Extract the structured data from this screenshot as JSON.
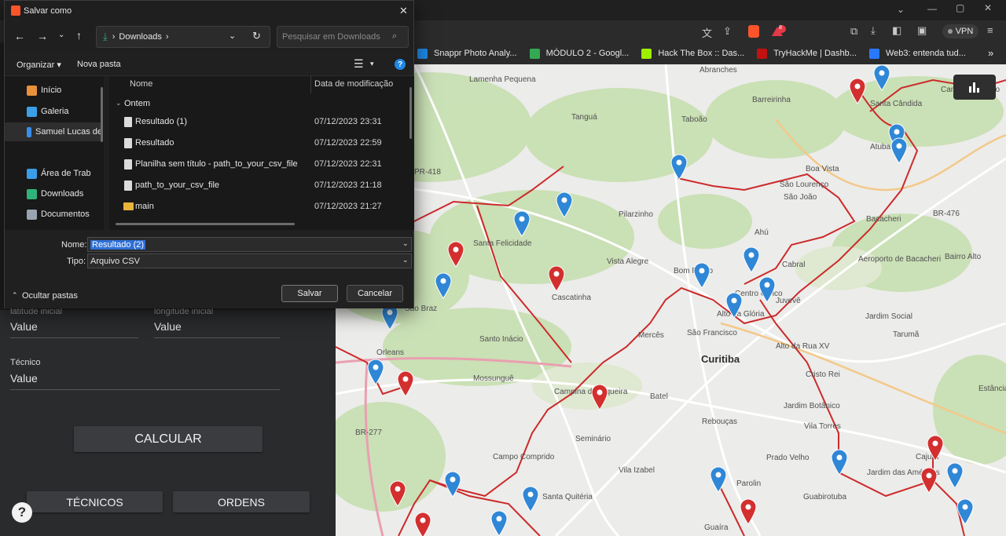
{
  "browser": {
    "bookmarks": [
      {
        "label": "Snappr Photo Analy...",
        "color": "#1e88e5"
      },
      {
        "label": "MÓDULO 2 - Googl...",
        "color": "#34a853"
      },
      {
        "label": "Hack The Box :: Das...",
        "color": "#9fef00"
      },
      {
        "label": "TryHackMe | Dashb...",
        "color": "#c11111"
      },
      {
        "label": "Web3: entenda tud...",
        "color": "#2979ff"
      }
    ],
    "more_bookmarks": "»",
    "vpn_label": "VPN",
    "brave_badge": "8"
  },
  "dialog": {
    "title": "Salvar como",
    "address": {
      "folder": "Downloads",
      "sep": "›"
    },
    "search_placeholder": "Pesquisar em Downloads",
    "cmd": {
      "organize": "Organizar ▾",
      "new_folder": "Nova pasta"
    },
    "nav_items": [
      {
        "label": "Início",
        "color": "#e8913b"
      },
      {
        "label": "Galeria",
        "color": "#3aa0e8"
      },
      {
        "label": "Samuel Lucas de",
        "color": "#3a8ee8"
      },
      {
        "label": "Área de Trab",
        "color": "#3a9ee8"
      },
      {
        "label": "Downloads",
        "color": "#2fb37a"
      },
      {
        "label": "Documentos",
        "color": "#9aa4b0"
      }
    ],
    "columns": {
      "name": "Nome",
      "date": "Data de modificação"
    },
    "group_label": "Ontem",
    "files": [
      {
        "name": "Resultado (1)",
        "date": "07/12/2023 23:31",
        "kind": "file"
      },
      {
        "name": "Resultado",
        "date": "07/12/2023 22:59",
        "kind": "file"
      },
      {
        "name": "Planilha sem título - path_to_your_csv_file",
        "date": "07/12/2023 22:31",
        "kind": "file"
      },
      {
        "name": "path_to_your_csv_file",
        "date": "07/12/2023 21:18",
        "kind": "file"
      },
      {
        "name": "main",
        "date": "07/12/2023 21:27",
        "kind": "folder"
      }
    ],
    "name_label": "Nome:",
    "name_value": "Resultado (2)",
    "type_label": "Tipo:",
    "type_value": "Arquivo CSV",
    "hide_folders": "Ocultar pastas",
    "save_button": "Salvar",
    "cancel_button": "Cancelar"
  },
  "app": {
    "lat_label": "latitude inicial",
    "lat_value": "Value",
    "lon_label": "longitude inicial",
    "lon_value": "Value",
    "tech_label": "Técnico",
    "tech_value": "Value",
    "calculate_button": "CALCULAR",
    "technicians_button": "TÉCNICOS",
    "orders_button": "ORDENS",
    "help_icon": "?"
  },
  "map": {
    "labels": [
      {
        "text": "Abranches",
        "cls": ""
      },
      {
        "text": "Lamenha Pequena",
        "cls": ""
      },
      {
        "text": "Barreirinha",
        "cls": ""
      },
      {
        "text": "Santa Cândida",
        "cls": ""
      },
      {
        "text": "Campo Pequeno",
        "cls": ""
      },
      {
        "text": "Tanguá",
        "cls": ""
      },
      {
        "text": "Taboão",
        "cls": ""
      },
      {
        "text": "Atuba",
        "cls": ""
      },
      {
        "text": "Boa Vista",
        "cls": ""
      },
      {
        "text": "São Lourenço",
        "cls": ""
      },
      {
        "text": "Bacacheri",
        "cls": ""
      },
      {
        "text": "BR-476",
        "cls": ""
      },
      {
        "text": "São João",
        "cls": ""
      },
      {
        "text": "Pilarzinho",
        "cls": ""
      },
      {
        "text": "Ahú",
        "cls": ""
      },
      {
        "text": "Aeroporto de Bacacheri",
        "cls": ""
      },
      {
        "text": "Bairro Alto",
        "cls": ""
      },
      {
        "text": "Santa Felicidade",
        "cls": ""
      },
      {
        "text": "Vista Alegre",
        "cls": ""
      },
      {
        "text": "Cabral",
        "cls": ""
      },
      {
        "text": "Bom Retiro",
        "cls": ""
      },
      {
        "text": "Cascatinha",
        "cls": ""
      },
      {
        "text": "Centro Cívico",
        "cls": ""
      },
      {
        "text": "Juvevê",
        "cls": ""
      },
      {
        "text": "São Braz",
        "cls": ""
      },
      {
        "text": "Jardim Social",
        "cls": ""
      },
      {
        "text": "Santo Inácio",
        "cls": ""
      },
      {
        "text": "Mercês",
        "cls": ""
      },
      {
        "text": "São Francisco",
        "cls": ""
      },
      {
        "text": "Alto da Glória",
        "cls": ""
      },
      {
        "text": "Tarumã",
        "cls": ""
      },
      {
        "text": "Alto da Rua XV",
        "cls": ""
      },
      {
        "text": "Orleans",
        "cls": ""
      },
      {
        "text": "Curitiba",
        "cls": "city"
      },
      {
        "text": "Cristo Rei",
        "cls": ""
      },
      {
        "text": "Mossunguê",
        "cls": ""
      },
      {
        "text": "Campina do Siqueira",
        "cls": ""
      },
      {
        "text": "Batel",
        "cls": ""
      },
      {
        "text": "Estância Pinhais",
        "cls": ""
      },
      {
        "text": "Jardim Botânico",
        "cls": ""
      },
      {
        "text": "BR-277",
        "cls": ""
      },
      {
        "text": "Seminário",
        "cls": ""
      },
      {
        "text": "Rebouças",
        "cls": ""
      },
      {
        "text": "Vila Torres",
        "cls": ""
      },
      {
        "text": "Campo Comprido",
        "cls": ""
      },
      {
        "text": "Prado Velho",
        "cls": ""
      },
      {
        "text": "Cajuru",
        "cls": ""
      },
      {
        "text": "Vila Izabel",
        "cls": ""
      },
      {
        "text": "Jardim das Américas",
        "cls": ""
      },
      {
        "text": "Parolin",
        "cls": ""
      },
      {
        "text": "Santa Quitéria",
        "cls": ""
      },
      {
        "text": "Guabirotuba",
        "cls": ""
      },
      {
        "text": "Guaíra",
        "cls": ""
      },
      {
        "text": "PR-418",
        "cls": ""
      }
    ]
  }
}
